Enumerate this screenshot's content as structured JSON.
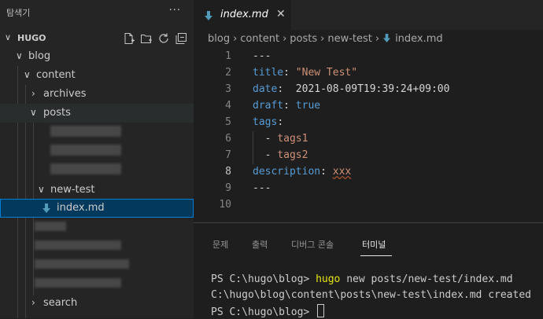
{
  "sidebar": {
    "title": "탐색기",
    "more_label": "···",
    "root": {
      "name": "HUGO"
    },
    "actions": [
      "new-file-icon",
      "new-folder-icon",
      "refresh-icon",
      "collapse-all-icon"
    ],
    "tree": {
      "blog": "blog",
      "content": "content",
      "archives": "archives",
      "posts": "posts",
      "new_test": "new-test",
      "index_md": "index.md",
      "search": "search"
    }
  },
  "editor": {
    "tab": {
      "label": "index.md",
      "close": "✕"
    },
    "breadcrumb": [
      "blog",
      "content",
      "posts",
      "new-test",
      "index.md"
    ],
    "lines": [
      {
        "n": "1",
        "text": "---"
      },
      {
        "n": "2",
        "key": "title",
        "value": "\"New Test\""
      },
      {
        "n": "3",
        "key": "date",
        "value": "2021-08-09T19:39:24+09:00"
      },
      {
        "n": "4",
        "key": "draft",
        "value": "true"
      },
      {
        "n": "5",
        "key": "tags"
      },
      {
        "n": "6",
        "item": "tags1"
      },
      {
        "n": "7",
        "item": "tags2"
      },
      {
        "n": "8",
        "key": "description",
        "value": "xxx"
      },
      {
        "n": "9",
        "text": "---"
      },
      {
        "n": "10",
        "text": ""
      }
    ],
    "active_line": "8"
  },
  "panel": {
    "tabs": [
      "문제",
      "출력",
      "디버그 콘솔",
      "터미널"
    ],
    "active_tab": "터미널",
    "terminal": {
      "line1_prompt": "PS C:\\hugo\\blog> ",
      "line1_cmd": "hugo",
      "line1_args": " new posts/new-test/index.md",
      "line2": "C:\\hugo\\blog\\content\\posts\\new-test\\index.md created",
      "line3_prompt": "PS C:\\hugo\\blog> "
    }
  },
  "colors": {
    "accent": "#007fd4",
    "selection": "#04395e",
    "md_icon": "#519aba"
  }
}
